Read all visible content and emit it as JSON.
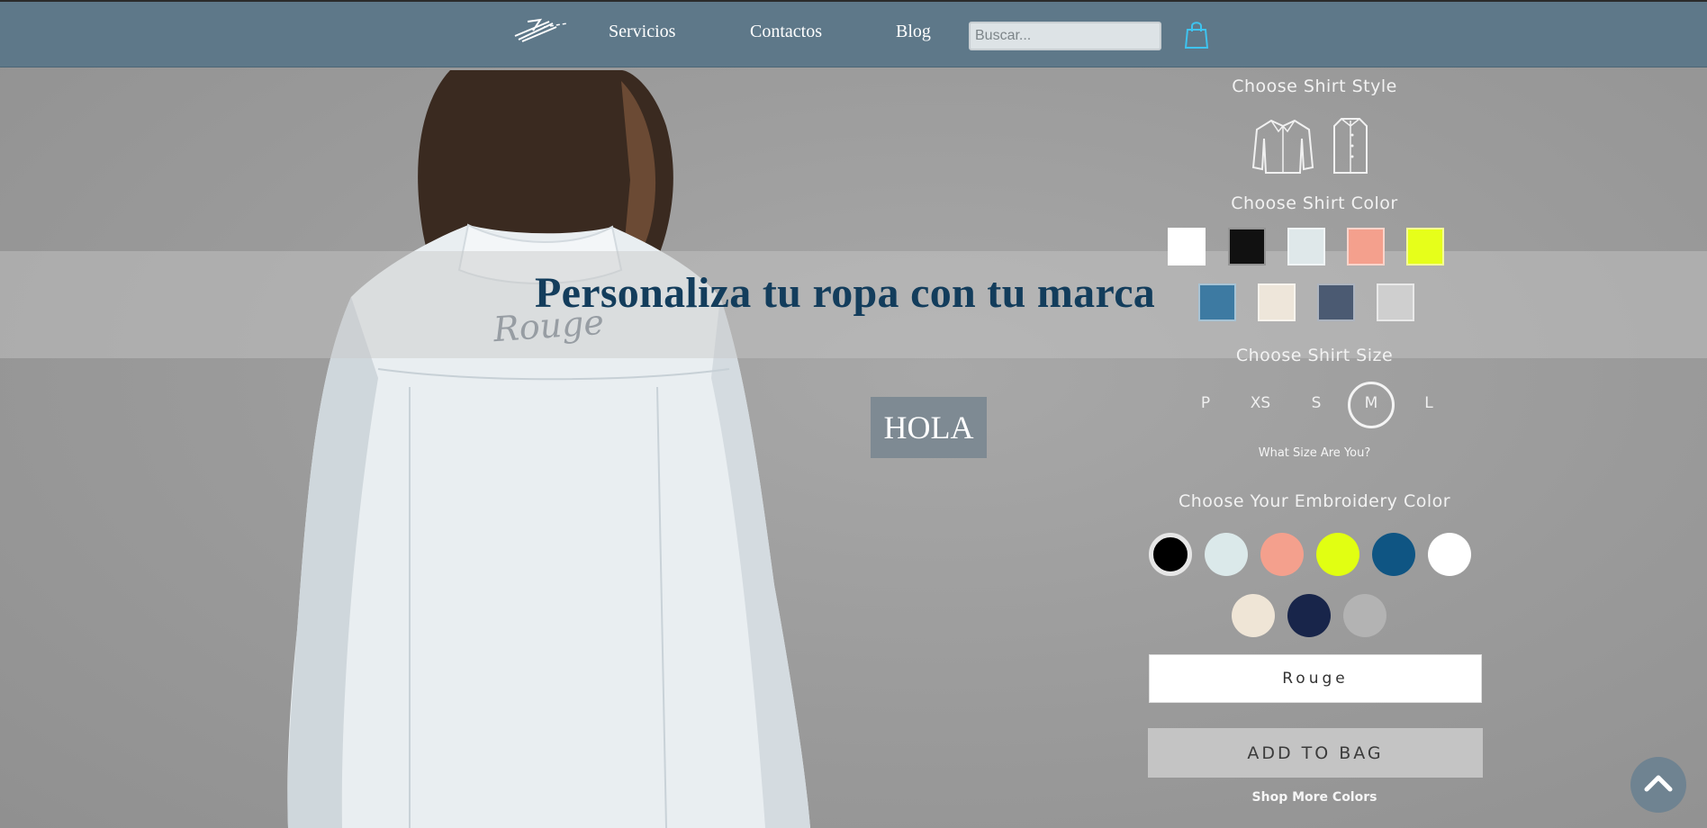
{
  "nav": {
    "links": [
      "Servicios",
      "Contactos",
      "Blog"
    ],
    "search_placeholder": "Buscar...",
    "bag_icon": "shopping-bag-icon",
    "logo_icon": "brand-logo-icon"
  },
  "hero": {
    "title": "Personaliza tu ropa con tu marca",
    "button_label": "HOLA",
    "shirt_embroidery": "Rouge"
  },
  "customizer": {
    "style_heading": "Choose Shirt Style",
    "style_options": [
      "long-sleeve-shirt-icon",
      "shirt-front-icon"
    ],
    "color_heading": "Choose Shirt Color",
    "shirt_colors": [
      "#ffffff",
      "#111111",
      "#dfe8ea",
      "#f4a08d",
      "#e6ff1a",
      "#3d7aa2",
      "#eee6da",
      "#4b5a72",
      "#cfcfcf"
    ],
    "size_heading": "Choose Shirt Size",
    "sizes": [
      "P",
      "XS",
      "S",
      "M",
      "L"
    ],
    "selected_size": "M",
    "size_help": "What Size Are You?",
    "embroidery_heading": "Choose Your Embroidery Color",
    "embroidery_colors": [
      "#000000",
      "#dbe9ea",
      "#f4a08d",
      "#e1ff12",
      "#0f5583",
      "#ffffff",
      "#efe5d6",
      "#18254a",
      "#b3b3b3"
    ],
    "selected_embroidery_color": "#000000",
    "embroidery_text": "Rouge",
    "add_to_bag": "ADD TO BAG",
    "shop_more": "Shop More Colors"
  },
  "scroll_top_icon": "chevron-up-icon"
}
